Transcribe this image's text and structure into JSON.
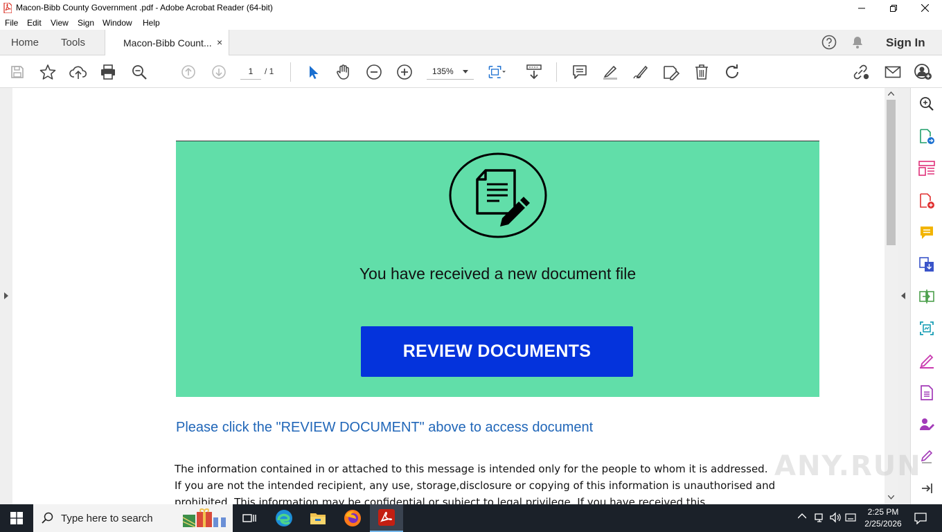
{
  "window": {
    "title": "Macon-Bibb County Government .pdf - Adobe Acrobat Reader (64-bit)",
    "accent_color": "#d92b1f"
  },
  "menu": [
    "File",
    "Edit",
    "View",
    "Sign",
    "Window",
    "Help"
  ],
  "tabs": {
    "home": "Home",
    "tools": "Tools",
    "document": "Macon-Bibb Count...",
    "close": "×",
    "sign_in": "Sign In"
  },
  "toolbar": {
    "page_current": "1",
    "page_total": "/ 1",
    "zoom": "135%"
  },
  "document": {
    "banner_message": "You have received a new document file",
    "button_label": "REVIEW DOCUMENTS",
    "banner_color": "#61dea9",
    "button_color": "#0433dc",
    "link_text": "Please click the \"REVIEW DOCUMENT\" above to access document",
    "disclaimer_lines": [
      "The information contained in or attached to this message is intended only for the people to whom it is addressed.",
      "If you are not the intended recipient, any use, storage,disclosure or copying of this information is unauthorised and",
      "prohibited. This information may be confidential or subject to legal privilege. If you have received this"
    ]
  },
  "taskbar": {
    "search_placeholder": "Type here to search",
    "time": "2:25 PM",
    "date": "2/25/2026"
  },
  "watermark": "ANY.RUN"
}
